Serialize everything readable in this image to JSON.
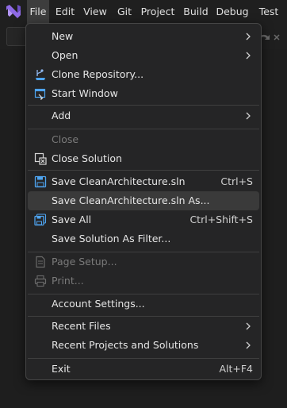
{
  "menubar": {
    "items": [
      "File",
      "Edit",
      "View",
      "Git",
      "Project",
      "Build",
      "Debug",
      "Test"
    ]
  },
  "file_menu": {
    "new": "New",
    "open": "Open",
    "clone_repository": "Clone Repository...",
    "start_window": "Start Window",
    "add": "Add",
    "close": "Close",
    "close_solution": "Close Solution",
    "save_solution": "Save CleanArchitecture.sln",
    "save_solution_shortcut": "Ctrl+S",
    "save_solution_as": "Save CleanArchitecture.sln As...",
    "save_all": "Save All",
    "save_all_shortcut": "Ctrl+Shift+S",
    "save_solution_filter": "Save Solution As Filter...",
    "page_setup": "Page Setup...",
    "print": "Print...",
    "account_settings": "Account Settings...",
    "recent_files": "Recent Files",
    "recent_projects": "Recent Projects and Solutions",
    "exit": "Exit",
    "exit_shortcut": "Alt+F4"
  },
  "colors": {
    "accent": "#8f6ae6",
    "save_icon": "#4ea4f0",
    "menu_bg": "#252526",
    "hover_bg": "#3a3a3a"
  }
}
